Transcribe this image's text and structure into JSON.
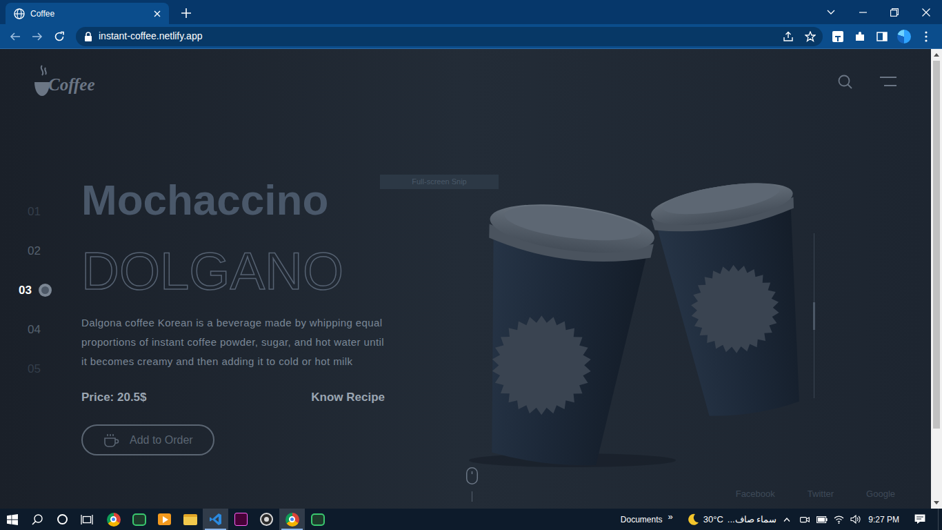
{
  "browser": {
    "tab": {
      "title": "Coffee",
      "selected": true
    },
    "address": "instant-coffee.netlify.app"
  },
  "page": {
    "logo": "Coffee",
    "slides": [
      {
        "label": "01",
        "selected": false
      },
      {
        "label": "02",
        "selected": false
      },
      {
        "label": "03",
        "selected": true
      },
      {
        "label": "04",
        "selected": false
      },
      {
        "label": "05",
        "selected": false
      }
    ],
    "title": "Mochaccino",
    "subtitle": "DOLGANO",
    "description": "Dalgona coffee Korean is a beverage made by whipping equal proportions of instant coffee powder, sugar, and hot water until it becomes creamy and then adding it to cold or hot milk",
    "price": "Price: 20.5$",
    "recipe_link": "Know Recipe",
    "order_button": "Add to Order",
    "slide_indicator": {
      "position": 0.5
    },
    "social_links": [
      "Facebook",
      "Twitter",
      "Google"
    ]
  },
  "snip_tooltip": "Full-screen Snip",
  "taskbar": {
    "apps": [
      {
        "kind": "chrome",
        "active": false
      },
      {
        "kind": "nox",
        "active": false
      },
      {
        "kind": "player",
        "active": false
      },
      {
        "kind": "explorer",
        "active": false
      },
      {
        "kind": "vscode",
        "active": true
      },
      {
        "kind": "xd",
        "active": false
      },
      {
        "kind": "obs",
        "active": false
      },
      {
        "kind": "chrome",
        "active": true
      },
      {
        "kind": "nox",
        "active": false
      }
    ],
    "toolbar": "Documents",
    "toolbar_more": "»",
    "temperature": "30°C",
    "weather": "سماء صاف...",
    "time": "9:27 PM"
  }
}
